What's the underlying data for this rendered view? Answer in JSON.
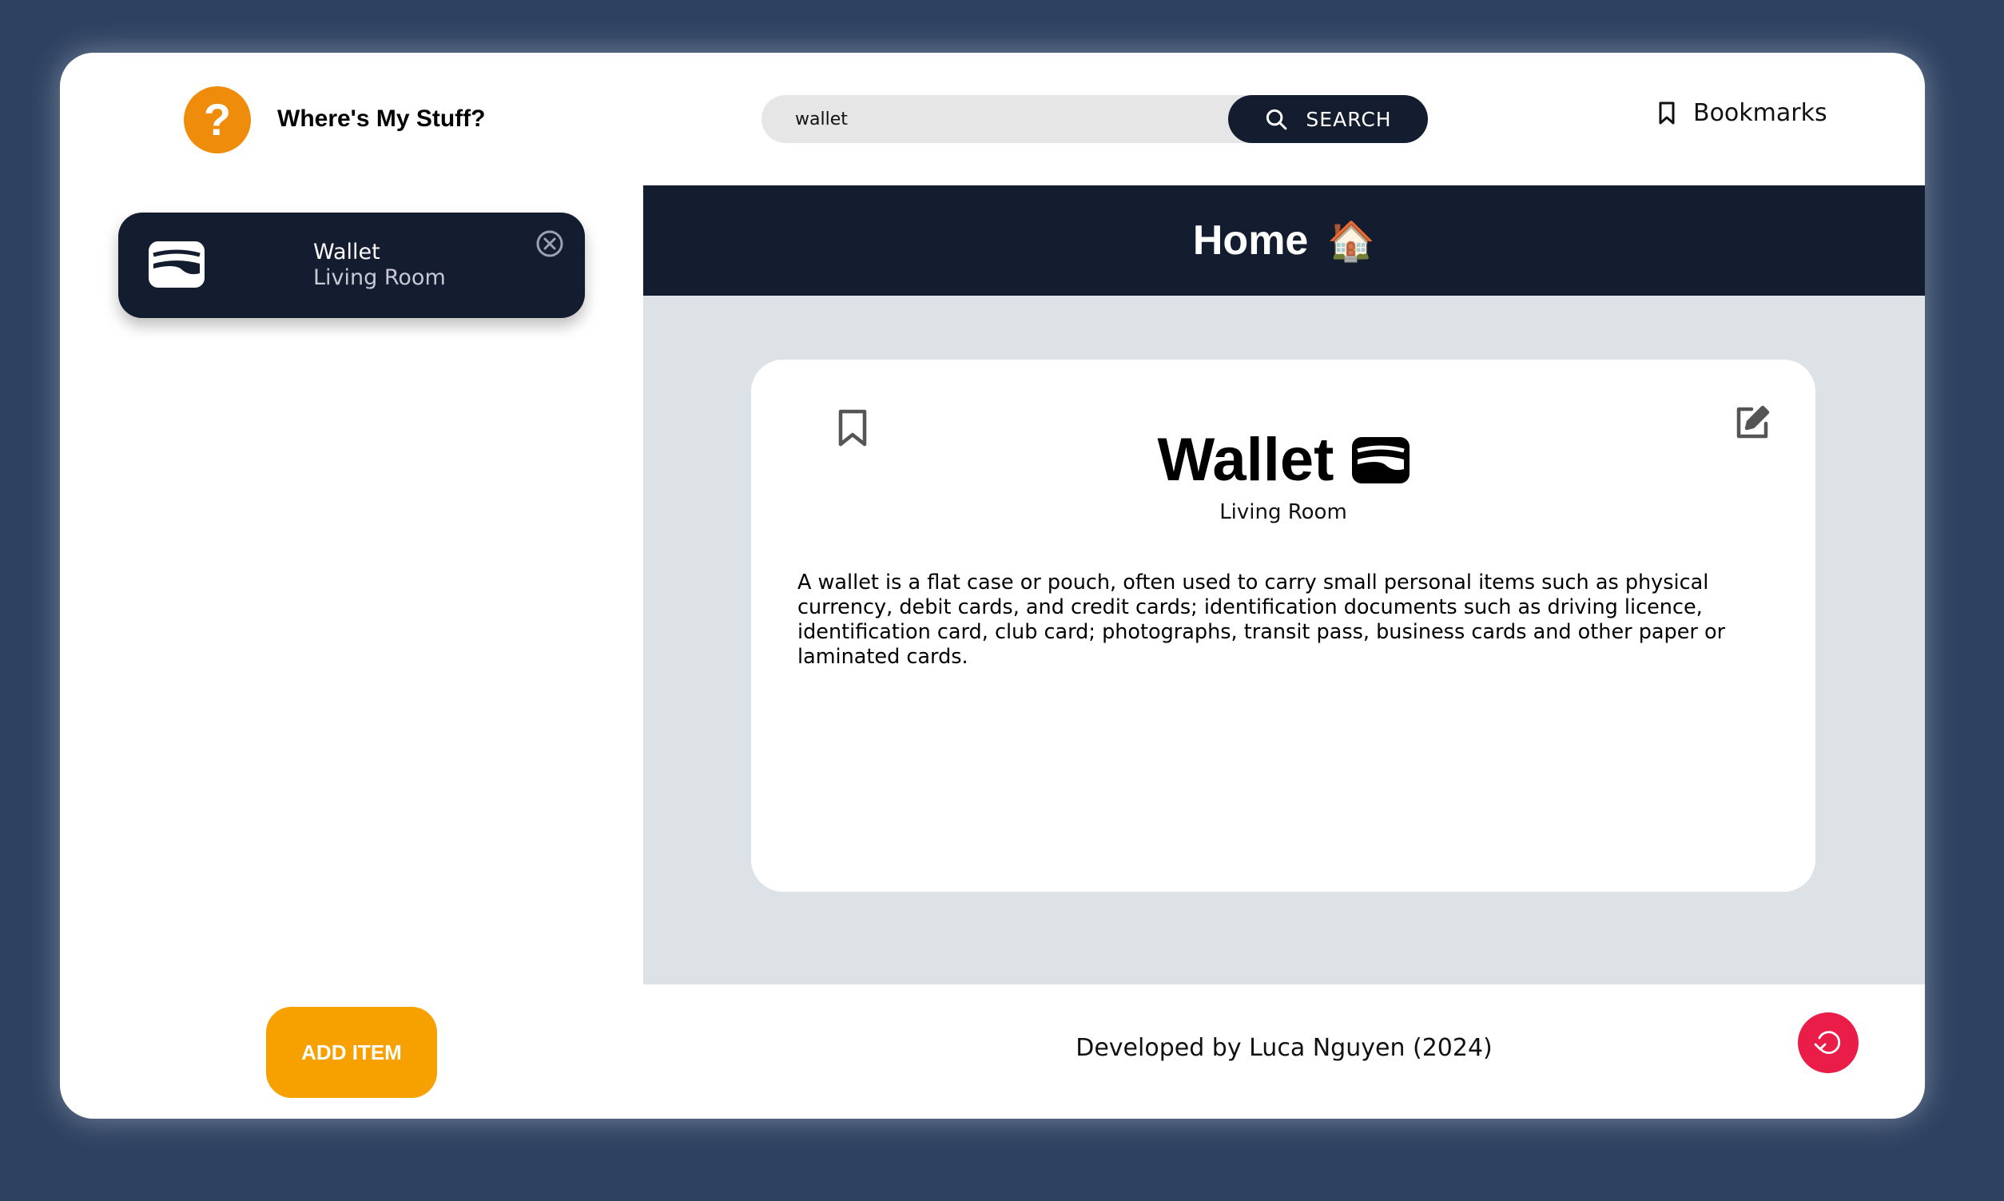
{
  "header": {
    "logo_glyph": "?",
    "app_title": "Where's My Stuff?",
    "search": {
      "value": "wallet",
      "button_label": "SEARCH"
    },
    "bookmarks_label": "Bookmarks"
  },
  "sidebar": {
    "items": [
      {
        "name": "Wallet",
        "location": "Living Room",
        "icon": "wallet-icon"
      }
    ]
  },
  "main": {
    "heading": "Home",
    "heading_emoji": "🏠",
    "item": {
      "name": "Wallet",
      "location": "Living Room",
      "description": "A wallet is a flat case or pouch, often used to carry small personal items such as physical currency, debit cards, and credit cards; identification documents such as driving licence, identification card, club card; photographs, transit pass, business cards and other paper or laminated cards."
    }
  },
  "footer": {
    "add_label": "ADD ITEM",
    "credit": "Developed by Luca Nguyen (2024)"
  },
  "colors": {
    "background": "#2d4261",
    "navy": "#141d30",
    "logo_orange": "#ef8c0c",
    "add_orange": "#f6a100",
    "reset_red": "#ea1c48",
    "panel_grey": "#dde2e7"
  }
}
